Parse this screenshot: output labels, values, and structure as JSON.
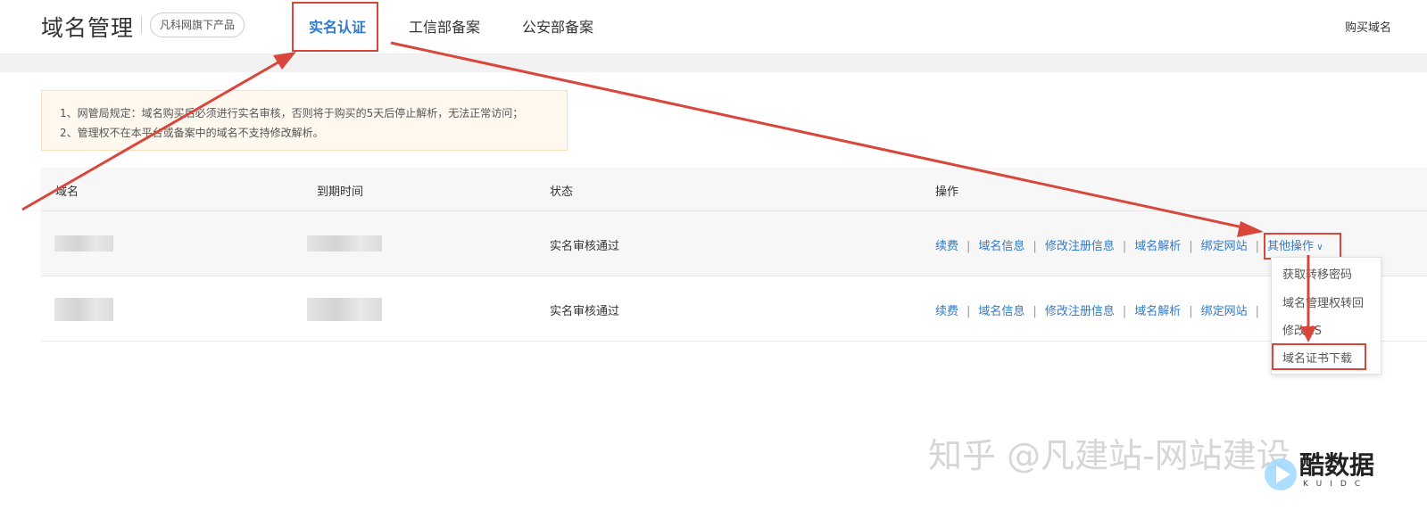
{
  "header": {
    "app_title": "域名管理",
    "product_badge": "凡科网旗下产品",
    "tabs": [
      {
        "label": "实名认证",
        "active": true
      },
      {
        "label": "工信部备案",
        "active": false
      },
      {
        "label": "公安部备案",
        "active": false
      }
    ],
    "buy_domain": "购买域名"
  },
  "notice": {
    "lines": [
      "1、网管局规定：域名购买后必须进行实名审核，否则将于购买的5天后停止解析，无法正常访问；",
      "2、管理权不在本平台或备案中的域名不支持修改解析。"
    ]
  },
  "table": {
    "headers": [
      "域名",
      "到期时间",
      "状态",
      "操作"
    ],
    "rows": [
      {
        "status": "实名审核通过"
      },
      {
        "status": "实名审核通过"
      }
    ],
    "actions": [
      "续费",
      "域名信息",
      "修改注册信息",
      "域名解析",
      "绑定网站"
    ],
    "more_actions": "其他操作",
    "more_menu": [
      "获取转移密码",
      "域名管理权转回",
      "修改NS",
      "域名证书下载"
    ]
  },
  "watermark": {
    "text": "知乎 @凡建站-网站建设",
    "logo_text": "酷数据",
    "logo_sub": "KUIDC"
  },
  "colors": {
    "accent": "#2f7ac9",
    "annotation_red": "#d9463c",
    "notice_bg": "#fff8ef"
  }
}
